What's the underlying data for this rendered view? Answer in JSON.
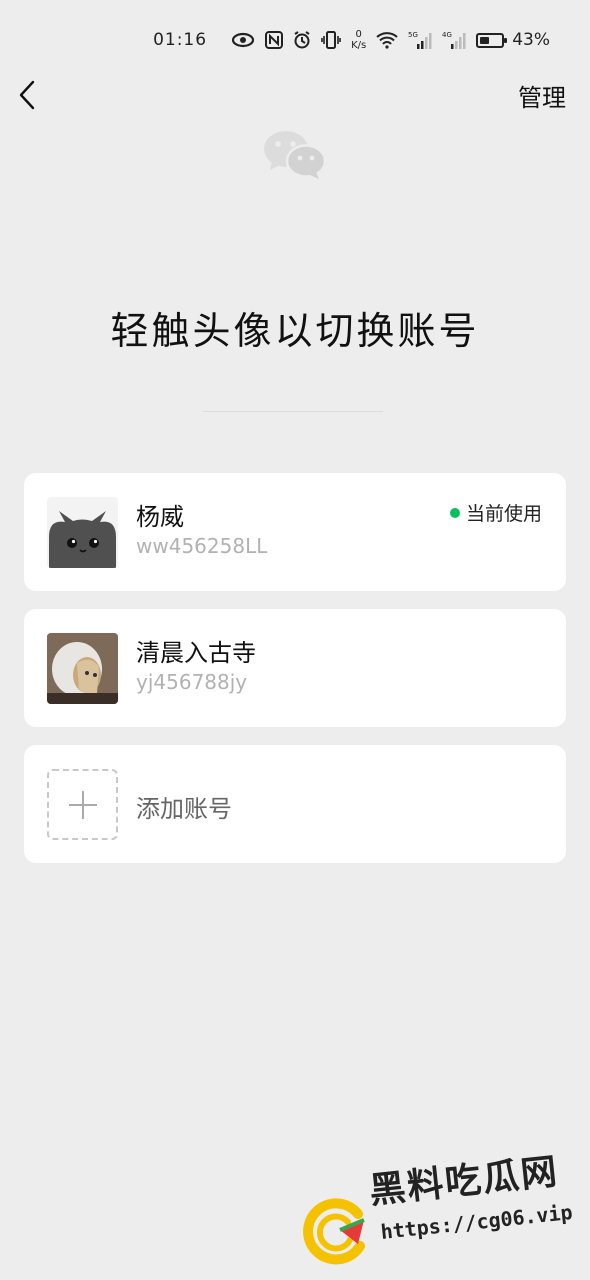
{
  "status_bar": {
    "time": "01:16",
    "net_speed_value": "0",
    "net_speed_unit": "K/s",
    "sig1": "5G",
    "sig2": "4G",
    "battery_percent_label": "43%",
    "battery_level": 0.43
  },
  "nav": {
    "manage_label": "管理"
  },
  "headline": "轻触头像以切换账号",
  "accounts": [
    {
      "name": "杨威",
      "wxid": "ww456258LL",
      "status": "当前使用"
    },
    {
      "name": "清晨入古寺",
      "wxid": "yj456788jy"
    }
  ],
  "add_account": {
    "label": "添加账号"
  },
  "watermark": {
    "title": "黑料吃瓜网",
    "url": "https://cg06.vip"
  },
  "colors": {
    "background": "#ededed",
    "card": "#ffffff",
    "accent_green": "#07c160",
    "secondary_text": "#b2b2b2"
  }
}
